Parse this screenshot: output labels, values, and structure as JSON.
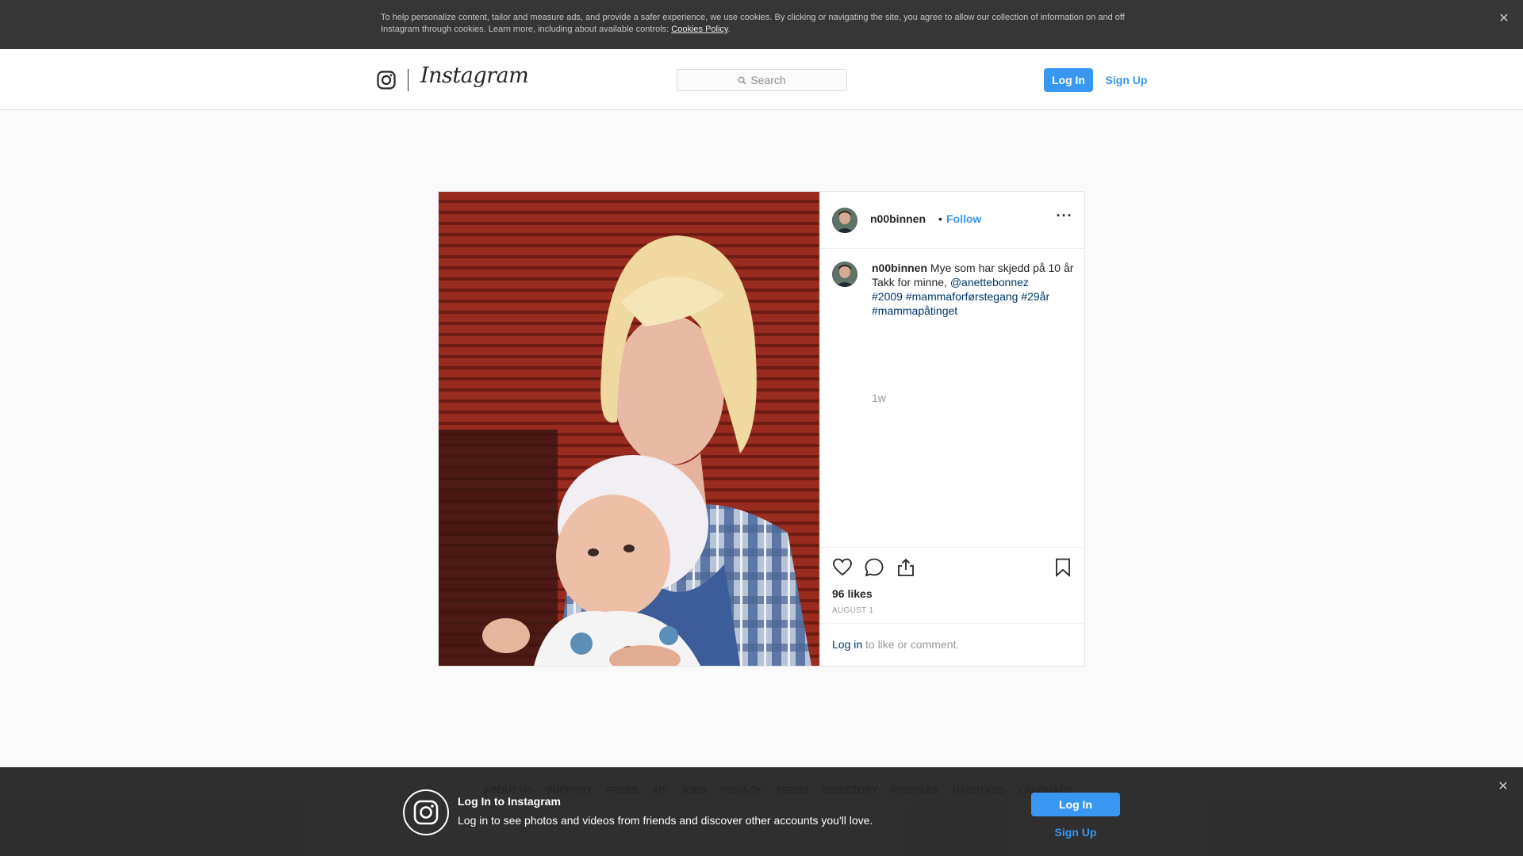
{
  "cookie_banner": {
    "text": "To help personalize content, tailor and measure ads, and provide a safer experience, we use cookies. By clicking or navigating the site, you agree to allow our collection of information on and off Instagram through cookies. Learn more, including about available controls:",
    "link_label": "Cookies Policy",
    "suffix": ".",
    "close_label": "✕"
  },
  "header": {
    "wordmark": "Instagram",
    "search_placeholder": "Search",
    "login_label": "Log In",
    "signup_label": "Sign Up"
  },
  "post": {
    "username": "n00binnen",
    "separator": "•",
    "follow_label": "Follow",
    "more_label": "···",
    "caption_text_1": " Mye som har skjedd på 10 år  Takk for minne, ",
    "mention": "@anettebonnez",
    "caption_text_2": " ",
    "hashtags": [
      "#2009",
      "#mammaforførstegang",
      "#29år",
      "#mammapåtinget"
    ],
    "time_ago": "1w",
    "likes": "96 likes",
    "date": "AUGUST 1",
    "login_prompt_link": "Log in",
    "login_prompt_text": "to like or comment."
  },
  "footer_nav": [
    "ABOUT US",
    "SUPPORT",
    "PRESS",
    "API",
    "JOBS",
    "PRIVACY",
    "TERMS",
    "DIRECTORY",
    "PROFILES",
    "HASHTAGS",
    "LANGUAGE"
  ],
  "bottom_bar": {
    "title": "Log In to Instagram",
    "description": "Log in to see photos and videos from friends and discover other accounts you'll love.",
    "login_label": "Log In",
    "signup_label": "Sign Up",
    "close_label": "✕"
  },
  "colors": {
    "accent": "#3897f0",
    "link_dark": "#003569",
    "banner_bg": "#363636"
  },
  "icons": {
    "search": "search-icon",
    "like": "heart-icon",
    "comment": "comment-icon",
    "share": "share-icon",
    "save": "bookmark-icon",
    "camera": "instagram-camera-icon"
  }
}
